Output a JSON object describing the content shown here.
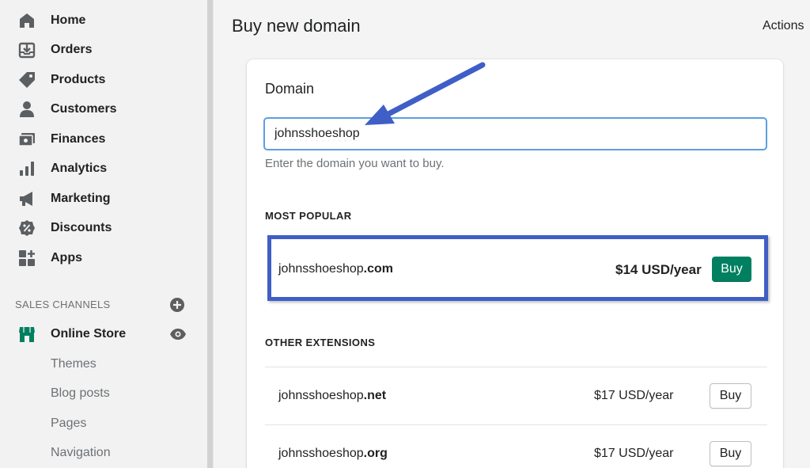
{
  "sidebar": {
    "items": [
      {
        "label": "Home",
        "icon": "home-icon"
      },
      {
        "label": "Orders",
        "icon": "orders-icon"
      },
      {
        "label": "Products",
        "icon": "tag-icon"
      },
      {
        "label": "Customers",
        "icon": "person-icon"
      },
      {
        "label": "Finances",
        "icon": "finances-icon"
      },
      {
        "label": "Analytics",
        "icon": "bar-chart-icon"
      },
      {
        "label": "Marketing",
        "icon": "megaphone-icon"
      },
      {
        "label": "Discounts",
        "icon": "discount-icon"
      },
      {
        "label": "Apps",
        "icon": "apps-icon"
      }
    ],
    "sales_channels_label": "SALES CHANNELS",
    "online_store": {
      "label": "Online Store",
      "icon": "store-icon"
    },
    "sub_items": [
      "Themes",
      "Blog posts",
      "Pages",
      "Navigation"
    ]
  },
  "header": {
    "title": "Buy new domain",
    "actions_label": "Actions"
  },
  "card": {
    "title": "Domain",
    "input_value": "johnsshoeshop",
    "help_text": "Enter the domain you want to buy.",
    "most_popular_heading": "MOST POPULAR",
    "most_popular": {
      "name": "johnsshoeshop",
      "ext": ".com",
      "price": "$14 USD/year",
      "buy_label": "Buy"
    },
    "other_heading": "OTHER EXTENSIONS",
    "others": [
      {
        "name": "johnsshoeshop",
        "ext": ".net",
        "price": "$17 USD/year",
        "buy_label": "Buy"
      },
      {
        "name": "johnsshoeshop",
        "ext": ".org",
        "price": "$17 USD/year",
        "buy_label": "Buy"
      }
    ]
  },
  "colors": {
    "accent_green": "#008060",
    "annotation_blue": "#3f5fc7",
    "input_focus": "#5c9ee3"
  }
}
